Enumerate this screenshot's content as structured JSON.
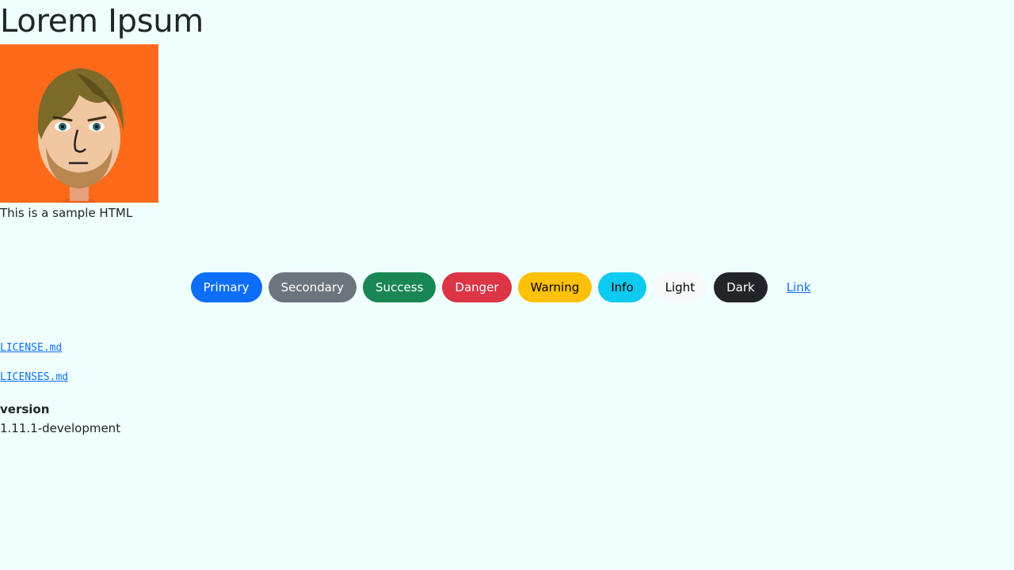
{
  "page": {
    "title": "Lorem Ipsum",
    "caption": "This is a sample HTML"
  },
  "avatar": {
    "background": "#ff6a1a",
    "icon": "mii-avatar"
  },
  "buttons": [
    {
      "label": "Primary",
      "variant": "primary",
      "color": "#0d6efd"
    },
    {
      "label": "Secondary",
      "variant": "secondary",
      "color": "#6c757d"
    },
    {
      "label": "Success",
      "variant": "success",
      "color": "#198754"
    },
    {
      "label": "Danger",
      "variant": "danger",
      "color": "#dc3545"
    },
    {
      "label": "Warning",
      "variant": "warning",
      "color": "#ffc107"
    },
    {
      "label": "Info",
      "variant": "info",
      "color": "#0dcaf0"
    },
    {
      "label": "Light",
      "variant": "light",
      "color": "#f8f9fa"
    },
    {
      "label": "Dark",
      "variant": "dark",
      "color": "#212529"
    },
    {
      "label": "Link",
      "variant": "link",
      "color": "#0d6efd"
    }
  ],
  "files": {
    "license": "LICENSE.md",
    "licenses": "LICENSES.md"
  },
  "meta": {
    "version_label": "version",
    "version_value": "1.11.1-development"
  }
}
